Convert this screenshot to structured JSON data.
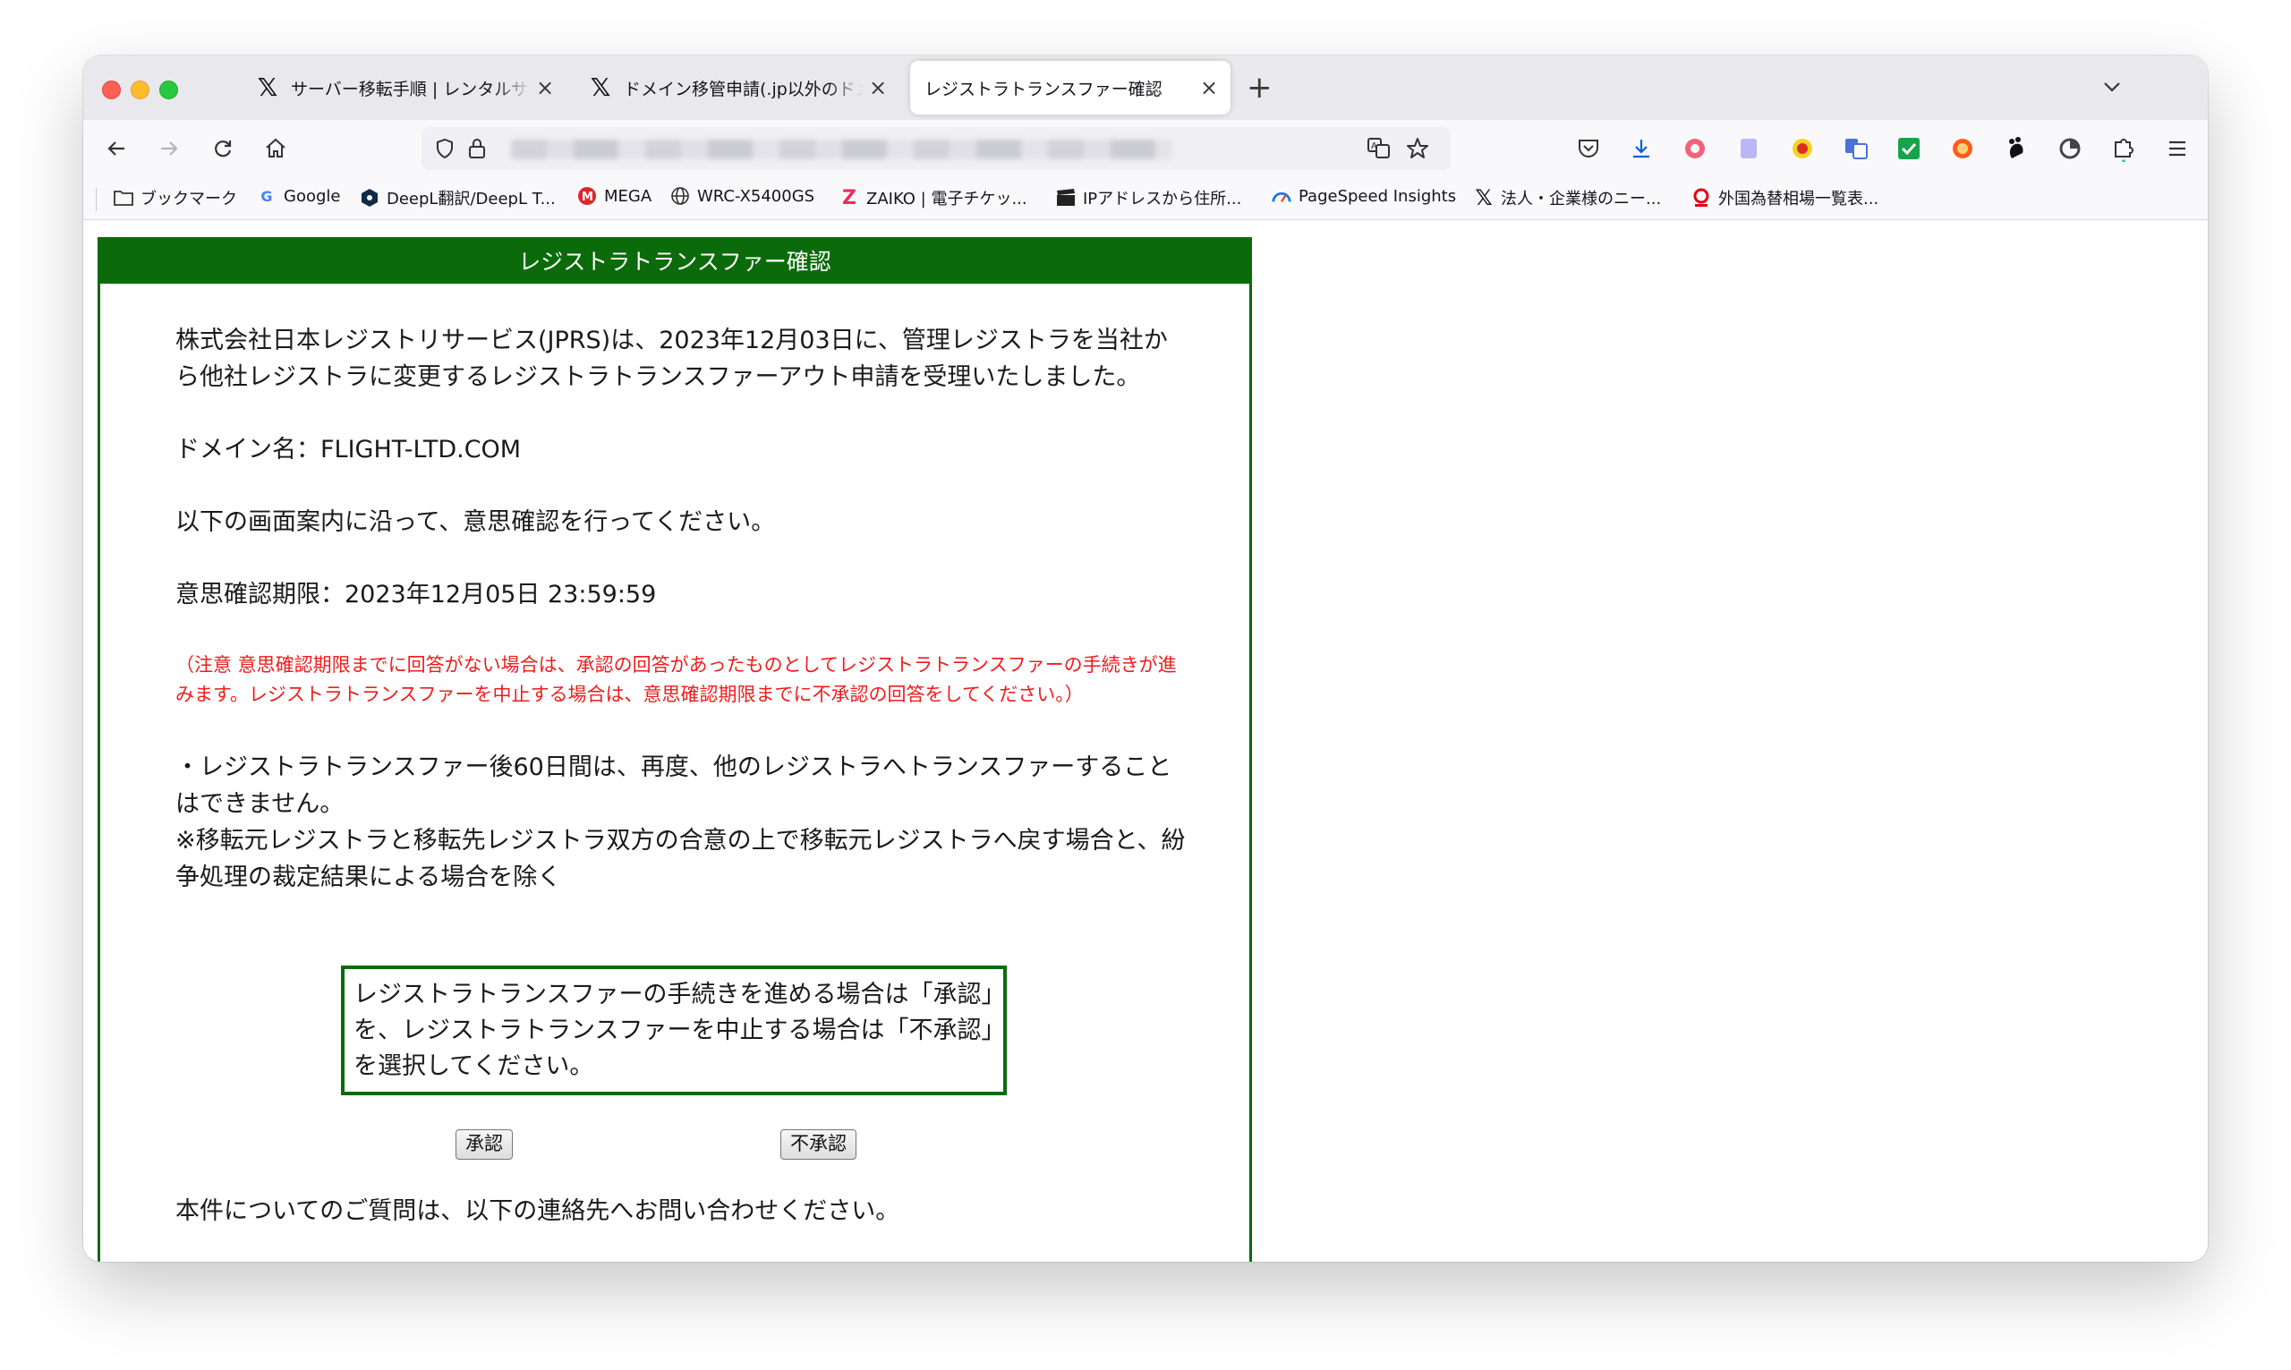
{
  "browser": {
    "tabs": [
      {
        "title": "サーバー移転手順 | レンタルサー",
        "favicon": "x-logo-icon",
        "active": false
      },
      {
        "title": "ドメイン移管申請(.jp以外のドメ",
        "favicon": "x-logo-icon",
        "active": false
      },
      {
        "title": "レジストラトランスファー確認",
        "favicon": "",
        "active": true
      }
    ],
    "new_tab_glyph": "+",
    "bookmarks": [
      {
        "label": "ブックマーク",
        "icon": "folder-icon"
      },
      {
        "label": "Google",
        "icon": "google-icon"
      },
      {
        "label": "DeepL翻訳/DeepL T...",
        "icon": "deepl-icon"
      },
      {
        "label": "MEGA",
        "icon": "mega-icon"
      },
      {
        "label": "WRC-X5400GS",
        "icon": "globe-icon"
      },
      {
        "label": "ZAIKO | 電子チケッ...",
        "icon": "zaiko-icon"
      },
      {
        "label": "IPアドレスから住所...",
        "icon": "clapper-icon"
      },
      {
        "label": "PageSpeed Insights",
        "icon": "pagespeed-icon"
      },
      {
        "label": "法人・企業様のニー...",
        "icon": "x-logo-icon"
      },
      {
        "label": "外国為替相場一覧表...",
        "icon": "mufg-icon"
      }
    ]
  },
  "page": {
    "header": "レジストラトランスファー確認",
    "intro": "株式会社日本レジストリサービス(JPRS)は、2023年12月03日に、管理レジストラを当社から他社レジストラに変更するレジストラトランスファーアウト申請を受理いたしました。",
    "domain_line": "ドメイン名：FLIGHT-LTD.COM",
    "instruction": "以下の画面案内に沿って、意思確認を行ってください。",
    "deadline": "意思確認期限：2023年12月05日 23:59:59",
    "warning": "（注意 意思確認期限までに回答がない場合は、承認の回答があったものとしてレジストラトランスファーの手続きが進みます。レジストラトランスファーを中止する場合は、意思確認期限までに不承認の回答をしてください。）",
    "note_1": "・レジストラトランスファー後60日間は、再度、他のレジストラへトランスファーすることはできません。",
    "note_2": "※移転元レジストラと移転先レジストラ双方の合意の上で移転元レジストラへ戻す場合と、紛争処理の裁定結果による場合を除く",
    "notice_box": "レジストラトランスファーの手続きを進める場合は「承認」を、レジストラトランスファーを中止する場合は「不承認」を選択してください。",
    "approve_label": "承認",
    "reject_label": "不承認",
    "contact": "本件についてのご質問は、以下の連絡先へお問い合わせください。"
  },
  "colors": {
    "header_green": "#0b6b0b",
    "warning_red": "#ee1c1c"
  }
}
